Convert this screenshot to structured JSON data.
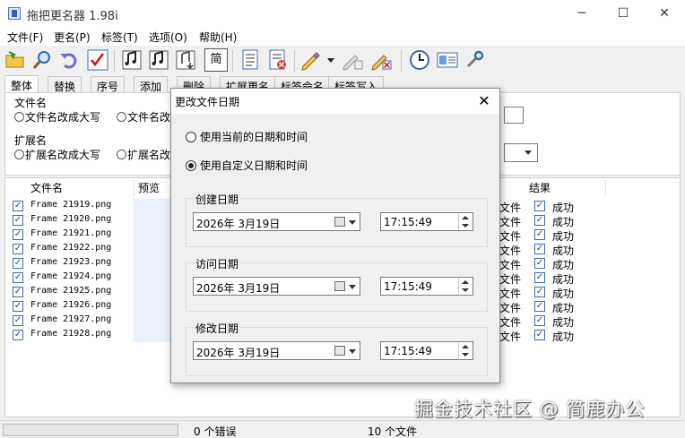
{
  "window": {
    "title": "拖把更名器 1.98i",
    "minimize": "─",
    "maximize": "☐",
    "close": "✕"
  },
  "menu": [
    "文件(F)",
    "更名(P)",
    "标签(T)",
    "选项(O)",
    "帮助(H)"
  ],
  "toolbar": {
    "simplified_label": "简"
  },
  "tabs": [
    "整体",
    "替换",
    "序号",
    "添加",
    "删除",
    "扩展更名",
    "标签命名",
    "标签写入"
  ],
  "panel": {
    "filename_group": "文件名",
    "filename_options": [
      "文件名改成大写",
      "文件名改"
    ],
    "ext_group": "扩展名",
    "ext_options": [
      "扩展名改成大写",
      "扩展名改"
    ]
  },
  "list": {
    "columns": {
      "filename": "文件名",
      "preview": "预览",
      "result": "结果"
    },
    "rows": [
      {
        "name": "Frame 21919.png",
        "type": "文件",
        "result": "成功"
      },
      {
        "name": "Frame 21920.png",
        "type": "文件",
        "result": "成功"
      },
      {
        "name": "Frame 21921.png",
        "type": "文件",
        "result": "成功"
      },
      {
        "name": "Frame 21922.png",
        "type": "文件",
        "result": "成功"
      },
      {
        "name": "Frame 21923.png",
        "type": "文件",
        "result": "成功"
      },
      {
        "name": "Frame 21924.png",
        "type": "文件",
        "result": "成功"
      },
      {
        "name": "Frame 21925.png",
        "type": "文件",
        "result": "成功"
      },
      {
        "name": "Frame 21926.png",
        "type": "文件",
        "result": "成功"
      },
      {
        "name": "Frame 21927.png",
        "type": "文件",
        "result": "成功"
      },
      {
        "name": "Frame 21928.png",
        "type": "文件",
        "result": "成功"
      }
    ]
  },
  "status": {
    "errors": "0 个错误",
    "files": "10 个文件"
  },
  "watermark": "掘金技术社区 @ 简鹿办公",
  "dialog": {
    "title": "更改文件日期",
    "close": "✕",
    "option_current": "使用当前的日期和时间",
    "option_custom": "使用自定义日期和时间",
    "created": {
      "label": "创建日期",
      "date": "2026年  3月19日",
      "time": "17:15:49"
    },
    "accessed": {
      "label": "访问日期",
      "date": "2026年  3月19日",
      "time": "17:15:49"
    },
    "modified": {
      "label": "修改日期",
      "date": "2026年  3月19日",
      "time": "17:15:49"
    }
  }
}
